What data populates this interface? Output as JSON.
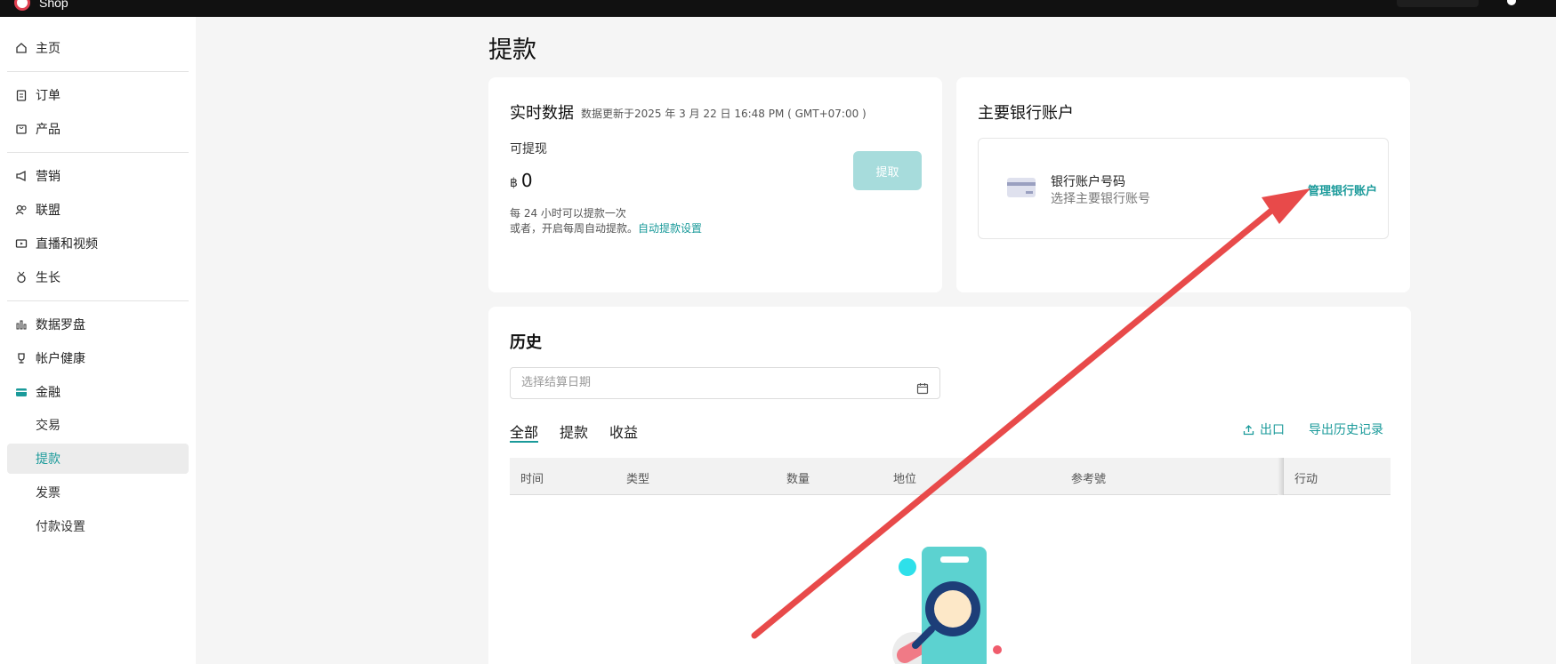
{
  "app": {
    "brand": "Shop"
  },
  "sidebar": {
    "items": [
      {
        "label": "主页"
      },
      {
        "label": "订单"
      },
      {
        "label": "产品"
      },
      {
        "label": "营销"
      },
      {
        "label": "联盟"
      },
      {
        "label": "直播和视频"
      },
      {
        "label": "生长"
      },
      {
        "label": "数据罗盘"
      },
      {
        "label": "帐户健康"
      },
      {
        "label": "金融"
      },
      {
        "label": "交易"
      },
      {
        "label": "提款"
      },
      {
        "label": "发票"
      },
      {
        "label": "付款设置"
      }
    ]
  },
  "page": {
    "title": "提款"
  },
  "realtime": {
    "title": "实时数据",
    "updated": "数据更新于2025 年 3 月 22 日 16:48 PM ( GMT+07:00 )",
    "available_label": "可提现",
    "currency": "฿",
    "amount": "0",
    "note1": "每 24 小时可以提款一次",
    "note2_prefix": "或者，开启每周自动提款。",
    "note2_link": "自动提款设置",
    "withdraw_button": "提取"
  },
  "bank": {
    "title": "主要银行账户",
    "account_label": "银行账户号码",
    "account_hint": "选择主要银行账号",
    "manage_link": "管理银行账户"
  },
  "history": {
    "title": "历史",
    "date_placeholder": "选择结算日期",
    "tabs": [
      {
        "label": "全部"
      },
      {
        "label": "提款"
      },
      {
        "label": "收益"
      }
    ],
    "export_label": "出口",
    "export_history_label": "导出历史记录",
    "columns": [
      "时间",
      "类型",
      "数量",
      "地位",
      "参考號",
      "行动"
    ]
  },
  "colors": {
    "accent": "#1a9a9a",
    "annotation_arrow": "#e84a4a"
  },
  "icons": {
    "home": "home-icon",
    "orders": "clipboard-icon",
    "products": "bag-icon",
    "marketing": "megaphone-icon",
    "affiliate": "users-icon",
    "live": "video-icon",
    "growth": "medal-icon",
    "data": "bar-chart-icon",
    "health": "trophy-icon",
    "finance": "wallet-icon",
    "calendar": "calendar-icon",
    "export": "upload-icon"
  }
}
